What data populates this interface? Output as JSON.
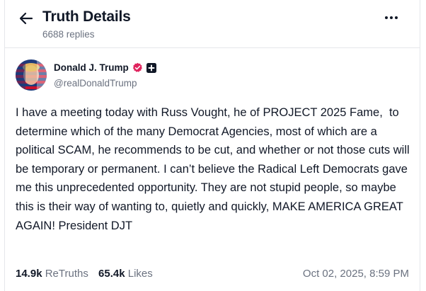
{
  "header": {
    "title": "Truth Details",
    "replies": "6688 replies"
  },
  "author": {
    "name": "Donald J. Trump",
    "handle": "@realDonaldTrump",
    "verified_color": "#e0245e"
  },
  "post": {
    "text": "I have a meeting today with Russ Vought, he of PROJECT 2025 Fame,  to determine which of the many Democrat Agencies, most of which are a political SCAM, he recommends to be cut, and whether or not those cuts will be temporary or permanent. I can’t believe the Radical Left Democrats gave me this unprecedented opportunity. They are not stupid people, so maybe this is their way of wanting to, quietly and quickly, MAKE AMERICA GREAT AGAIN! President DJT"
  },
  "stats": {
    "retruths_count": "14.9k",
    "retruths_label": "ReTruths",
    "likes_count": "65.4k",
    "likes_label": "Likes",
    "timestamp": "Oct 02, 2025, 8:59 PM"
  },
  "icons": {
    "back": "arrow-left-icon",
    "more": "more-horizontal-icon",
    "verified": "verified-badge-icon",
    "plus": "plus-badge-icon"
  }
}
